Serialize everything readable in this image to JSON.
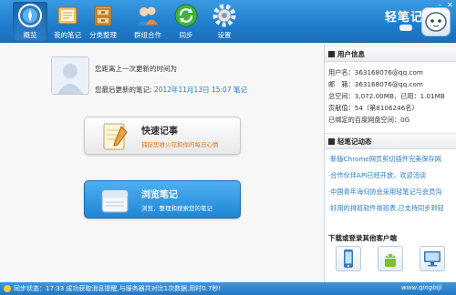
{
  "toolbar": {
    "items": [
      {
        "label": "概览",
        "icon": "compass-icon"
      },
      {
        "label": "我的笔记",
        "icon": "notebook-icon"
      },
      {
        "label": "分类整理",
        "icon": "drawer-icon"
      },
      {
        "label": "群组合作",
        "icon": "group-icon"
      },
      {
        "label": "同步",
        "icon": "sync-icon"
      },
      {
        "label": "设置",
        "icon": "gear-icon"
      }
    ],
    "active_index": 0
  },
  "brand": {
    "title": "轻笔记"
  },
  "window": {
    "minimize": "–",
    "close": "✕"
  },
  "main": {
    "last_update_label": "您距离上一次更新的时间为",
    "last_updated_label": "您最后更新的笔记:",
    "last_updated_value": "2012年11月13日 15:07 笔记",
    "quick_note": {
      "title": "快速记事",
      "subtitle": "捕捉思维火花和你的每日心情"
    },
    "browse_notes": {
      "title": "浏览笔记",
      "subtitle": "浏览，整理和搜索您的笔记"
    }
  },
  "user_info": {
    "heading": "用户信息",
    "rows": [
      "用户名：363168076@qq.com",
      "邮　箱：363168076@qq.com",
      "总空间：3,072.00MB，已用：1.01MB",
      "贡献值：54（第8106246名）",
      "已绑定的百度网盘空间：0G"
    ]
  },
  "news": {
    "heading": "轻笔记动态",
    "items": [
      "·新版Chrome网页剪切插件完美保存网",
      "·合作伙伴API已经开放，欢迎洽谈",
      "·中国青年海归协会采用轻笔记与会员沟",
      "·好用的排班软件排班表,已支持同步到轻"
    ]
  },
  "clients": {
    "heading": "下载或登录其他客户端"
  },
  "status": {
    "text": "同步状态：17:33 成功获取消息提醒,与服务器共对比1次数据,用时0.7秒!",
    "site": "www.qingbiji"
  },
  "colors": {
    "toolbar": "#1f7dcc",
    "link": "#2a7ac6",
    "accent_orange": "#e07a1a"
  }
}
